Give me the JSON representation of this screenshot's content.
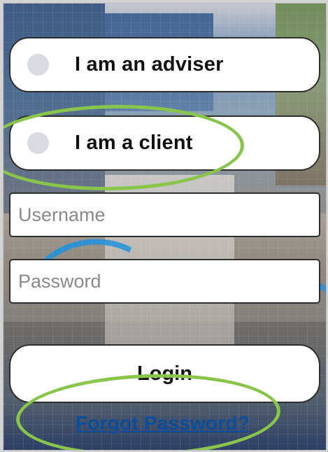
{
  "login_form": {
    "role_options": [
      {
        "label": "I am an adviser"
      },
      {
        "label": "I am a client"
      }
    ],
    "username_placeholder": "Username",
    "password_placeholder": "Password",
    "login_label": "Login",
    "forgot_password_label": "Forgot Password?"
  },
  "icons": {
    "radio": "radio-circle-icon"
  },
  "colors": {
    "card_background": "#ffffff",
    "card_border": "#2e2e2e",
    "radio_fill": "#d9dde2",
    "placeholder_text": "#8a8a8a",
    "link": "#0b4d9a",
    "highlight": "#8ac54b"
  }
}
